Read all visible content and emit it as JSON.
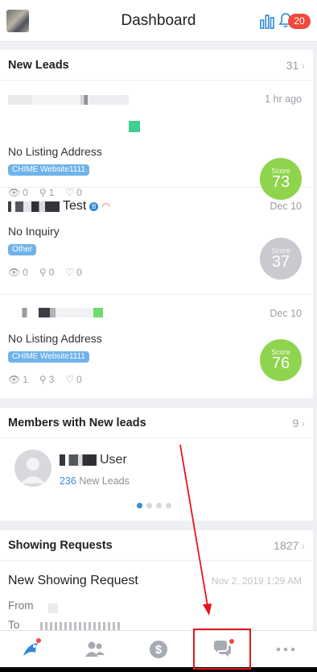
{
  "header": {
    "title": "Dashboard",
    "notifications_badge": "20",
    "accent": "#2f86d6"
  },
  "new_leads": {
    "title": "New Leads",
    "count": "31",
    "items": [
      {
        "time": "1 hr ago",
        "address": "No Listing Address",
        "tag": "CHIME Website1111",
        "views": "0",
        "searches": "1",
        "favorites": "0",
        "score_label": "Score",
        "score": "73",
        "score_color": "#8fd44d"
      },
      {
        "name_suffix": "Test",
        "time": "Dec 10",
        "address": "No Inquiry",
        "tag": "Other",
        "views": "0",
        "searches": "0",
        "favorites": "0",
        "score_label": "Score",
        "score": "37",
        "score_color": "#c8cacf"
      },
      {
        "time": "Dec 10",
        "address": "No Listing Address",
        "tag": "CHIME Website1111",
        "views": "1",
        "searches": "3",
        "favorites": "0",
        "score_label": "Score",
        "score": "76",
        "score_color": "#8fd44d"
      }
    ]
  },
  "members": {
    "title": "Members with New leads",
    "count": "9",
    "member_name_suffix": "User",
    "leads_count": "236",
    "leads_label": "New Leads"
  },
  "showing": {
    "title": "Showing Requests",
    "count": "1827",
    "item_title": "New Showing Request",
    "item_time": "Nov 2, 2019 1:29 AM",
    "from_label": "From",
    "to_label": "To"
  },
  "tabbar": {
    "tabs": [
      "home-icon",
      "contacts-icon",
      "dollar-icon",
      "chat-icon",
      "more-icon"
    ]
  }
}
